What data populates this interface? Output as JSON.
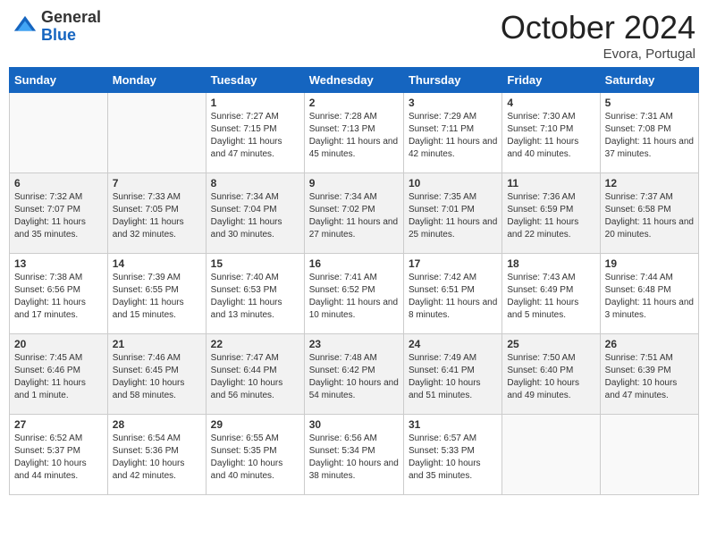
{
  "header": {
    "logo_line1": "General",
    "logo_line2": "Blue",
    "month": "October 2024",
    "location": "Evora, Portugal"
  },
  "columns": [
    "Sunday",
    "Monday",
    "Tuesday",
    "Wednesday",
    "Thursday",
    "Friday",
    "Saturday"
  ],
  "weeks": [
    [
      {
        "day": "",
        "info": ""
      },
      {
        "day": "",
        "info": ""
      },
      {
        "day": "1",
        "info": "Sunrise: 7:27 AM\nSunset: 7:15 PM\nDaylight: 11 hours and 47 minutes."
      },
      {
        "day": "2",
        "info": "Sunrise: 7:28 AM\nSunset: 7:13 PM\nDaylight: 11 hours and 45 minutes."
      },
      {
        "day": "3",
        "info": "Sunrise: 7:29 AM\nSunset: 7:11 PM\nDaylight: 11 hours and 42 minutes."
      },
      {
        "day": "4",
        "info": "Sunrise: 7:30 AM\nSunset: 7:10 PM\nDaylight: 11 hours and 40 minutes."
      },
      {
        "day": "5",
        "info": "Sunrise: 7:31 AM\nSunset: 7:08 PM\nDaylight: 11 hours and 37 minutes."
      }
    ],
    [
      {
        "day": "6",
        "info": "Sunrise: 7:32 AM\nSunset: 7:07 PM\nDaylight: 11 hours and 35 minutes."
      },
      {
        "day": "7",
        "info": "Sunrise: 7:33 AM\nSunset: 7:05 PM\nDaylight: 11 hours and 32 minutes."
      },
      {
        "day": "8",
        "info": "Sunrise: 7:34 AM\nSunset: 7:04 PM\nDaylight: 11 hours and 30 minutes."
      },
      {
        "day": "9",
        "info": "Sunrise: 7:34 AM\nSunset: 7:02 PM\nDaylight: 11 hours and 27 minutes."
      },
      {
        "day": "10",
        "info": "Sunrise: 7:35 AM\nSunset: 7:01 PM\nDaylight: 11 hours and 25 minutes."
      },
      {
        "day": "11",
        "info": "Sunrise: 7:36 AM\nSunset: 6:59 PM\nDaylight: 11 hours and 22 minutes."
      },
      {
        "day": "12",
        "info": "Sunrise: 7:37 AM\nSunset: 6:58 PM\nDaylight: 11 hours and 20 minutes."
      }
    ],
    [
      {
        "day": "13",
        "info": "Sunrise: 7:38 AM\nSunset: 6:56 PM\nDaylight: 11 hours and 17 minutes."
      },
      {
        "day": "14",
        "info": "Sunrise: 7:39 AM\nSunset: 6:55 PM\nDaylight: 11 hours and 15 minutes."
      },
      {
        "day": "15",
        "info": "Sunrise: 7:40 AM\nSunset: 6:53 PM\nDaylight: 11 hours and 13 minutes."
      },
      {
        "day": "16",
        "info": "Sunrise: 7:41 AM\nSunset: 6:52 PM\nDaylight: 11 hours and 10 minutes."
      },
      {
        "day": "17",
        "info": "Sunrise: 7:42 AM\nSunset: 6:51 PM\nDaylight: 11 hours and 8 minutes."
      },
      {
        "day": "18",
        "info": "Sunrise: 7:43 AM\nSunset: 6:49 PM\nDaylight: 11 hours and 5 minutes."
      },
      {
        "day": "19",
        "info": "Sunrise: 7:44 AM\nSunset: 6:48 PM\nDaylight: 11 hours and 3 minutes."
      }
    ],
    [
      {
        "day": "20",
        "info": "Sunrise: 7:45 AM\nSunset: 6:46 PM\nDaylight: 11 hours and 1 minute."
      },
      {
        "day": "21",
        "info": "Sunrise: 7:46 AM\nSunset: 6:45 PM\nDaylight: 10 hours and 58 minutes."
      },
      {
        "day": "22",
        "info": "Sunrise: 7:47 AM\nSunset: 6:44 PM\nDaylight: 10 hours and 56 minutes."
      },
      {
        "day": "23",
        "info": "Sunrise: 7:48 AM\nSunset: 6:42 PM\nDaylight: 10 hours and 54 minutes."
      },
      {
        "day": "24",
        "info": "Sunrise: 7:49 AM\nSunset: 6:41 PM\nDaylight: 10 hours and 51 minutes."
      },
      {
        "day": "25",
        "info": "Sunrise: 7:50 AM\nSunset: 6:40 PM\nDaylight: 10 hours and 49 minutes."
      },
      {
        "day": "26",
        "info": "Sunrise: 7:51 AM\nSunset: 6:39 PM\nDaylight: 10 hours and 47 minutes."
      }
    ],
    [
      {
        "day": "27",
        "info": "Sunrise: 6:52 AM\nSunset: 5:37 PM\nDaylight: 10 hours and 44 minutes."
      },
      {
        "day": "28",
        "info": "Sunrise: 6:54 AM\nSunset: 5:36 PM\nDaylight: 10 hours and 42 minutes."
      },
      {
        "day": "29",
        "info": "Sunrise: 6:55 AM\nSunset: 5:35 PM\nDaylight: 10 hours and 40 minutes."
      },
      {
        "day": "30",
        "info": "Sunrise: 6:56 AM\nSunset: 5:34 PM\nDaylight: 10 hours and 38 minutes."
      },
      {
        "day": "31",
        "info": "Sunrise: 6:57 AM\nSunset: 5:33 PM\nDaylight: 10 hours and 35 minutes."
      },
      {
        "day": "",
        "info": ""
      },
      {
        "day": "",
        "info": ""
      }
    ]
  ]
}
